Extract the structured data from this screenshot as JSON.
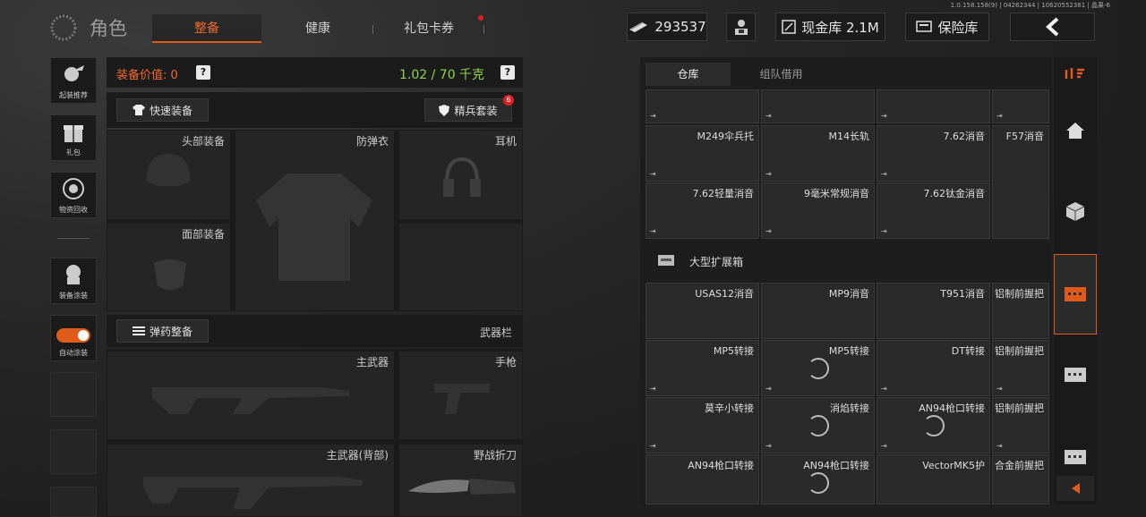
{
  "version": "1.0.158.158(9) | 04262344 | 10620552381 | 晶果-6",
  "header": {
    "title": "角色",
    "tabs": [
      {
        "label": "整备",
        "active": true
      },
      {
        "label": "健康",
        "active": false
      },
      {
        "label": "礼包卡券",
        "active": false
      }
    ],
    "currency": "293537",
    "cash_vault": "现金库 2.1M",
    "safe_vault": "保险库"
  },
  "left_bar": [
    {
      "label": "起装推荐",
      "icon": "loadout-icon"
    },
    {
      "label": "礼包",
      "icon": "gift-icon"
    },
    {
      "label": "物资回收",
      "icon": "recycle-icon"
    },
    {
      "label": "装备涂装",
      "icon": "skin-icon"
    },
    {
      "label": "自动涂装",
      "icon": "toggle-icon"
    }
  ],
  "equip": {
    "value_label": "装备价值: 0",
    "weight": "1.02 / 70 千克",
    "help": "?",
    "quick_equip": "快速装备",
    "elite_set": "精兵套装",
    "elite_badge": "6",
    "slots": {
      "head": "头部装备",
      "armor": "防弹衣",
      "headset": "耳机",
      "face": "面部装备"
    },
    "ammo_btn": "弹药整备",
    "weapon_bar": "武器栏",
    "weapons": {
      "primary": "主武器",
      "pistol": "手枪",
      "primary_back": "主武器(背部)",
      "knife": "野战折刀"
    }
  },
  "storage": {
    "tabs": [
      {
        "label": "仓库",
        "active": true
      },
      {
        "label": "组队借用",
        "active": false
      }
    ],
    "enter_icon": "⇥",
    "group1": [
      "M249伞兵托",
      "M14长轨",
      "7.62消音",
      "F57消音",
      "7.62轻量消音",
      "9毫米常规消音",
      "7.62钛金消音"
    ],
    "container": "大型扩展箱",
    "group2": [
      "USAS12消音",
      "MP9消音",
      "T951消音",
      "铝制前握把",
      "MP5转接",
      "MP5转接",
      "DT转接",
      "铝制前握把",
      "莫辛小转接",
      "消焰转接",
      "AN94枪口转接",
      "铝制前握把",
      "AN94枪口转接",
      "AN94枪口转接",
      "VectorMK5护",
      "合金前握把"
    ]
  },
  "colors": {
    "accent": "#e05a1a",
    "weight": "#8ed34a",
    "value": "#f06a2a"
  }
}
